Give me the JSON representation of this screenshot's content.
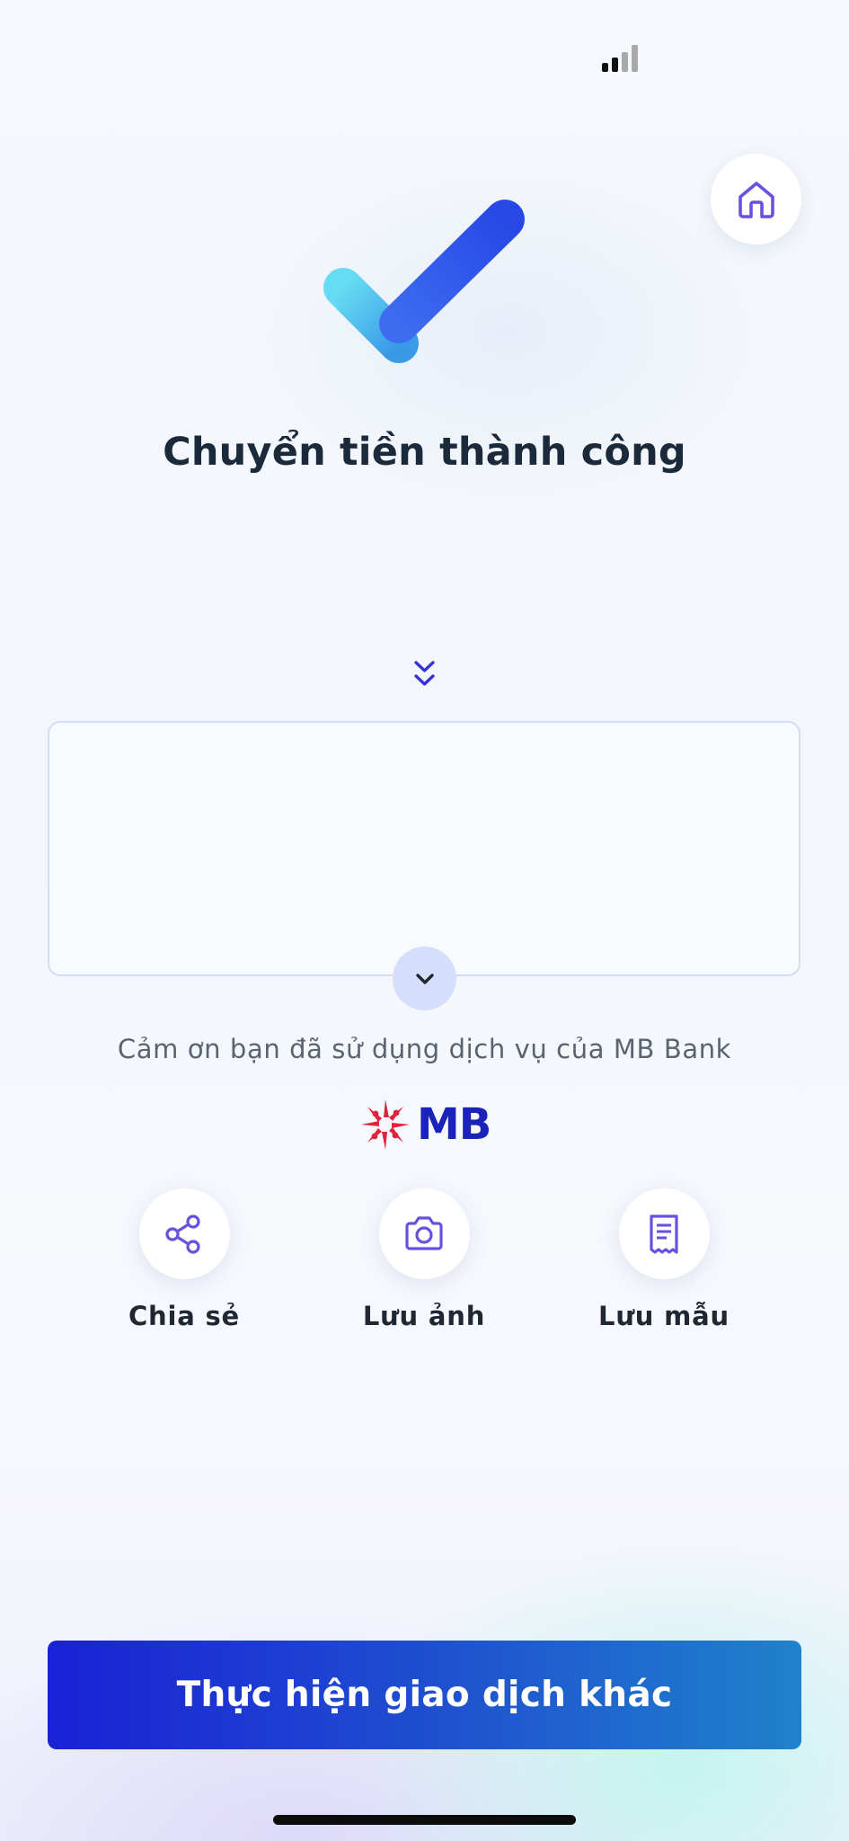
{
  "status_bar": {
    "signal_strength": "2 of 4 bars",
    "signal_colors": {
      "active": "#111111",
      "inactive": "#a9a9a9"
    }
  },
  "header": {
    "home_icon": "home-icon"
  },
  "result": {
    "icon": "success-check-icon",
    "title": "Chuyển tiền thành công"
  },
  "details": {
    "scroll_hint_icon": "double-chevron-down-icon",
    "expand_icon": "chevron-down-icon"
  },
  "footer": {
    "thanks_text": "Cảm ơn bạn đã sử dụng dịch vụ của MB Bank",
    "logo_text": "MB",
    "logo_colors": {
      "star": "#e0243d",
      "text": "#1b23b8"
    }
  },
  "actions": [
    {
      "label": "Chia sẻ",
      "icon": "share-icon"
    },
    {
      "label": "Lưu ảnh",
      "icon": "camera-icon"
    },
    {
      "label": "Lưu mẫu",
      "icon": "receipt-icon"
    }
  ],
  "cta": {
    "label": "Thực hiện giao dịch khác",
    "gradient": [
      "#1a21d6",
      "#1f82cc"
    ]
  },
  "theme": {
    "accent": "#6a4fe0",
    "title_color": "#1b2a3a"
  }
}
